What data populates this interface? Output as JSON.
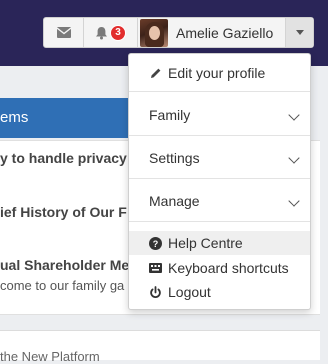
{
  "header": {
    "notification_count": "3",
    "user_name": "Amelie Gaziello"
  },
  "section": {
    "title": "ems"
  },
  "news": [
    {
      "title": "y to handle privacy a"
    },
    {
      "title": "ief History of Our F"
    },
    {
      "title": "ual Shareholder Me",
      "subtitle": "come to our family ga"
    }
  ],
  "bottom_text": "the New Platform",
  "menu": {
    "edit_profile": "Edit your profile",
    "family": "Family",
    "settings": "Settings",
    "manage": "Manage",
    "help_centre": "Help Centre",
    "keyboard_shortcuts": "Keyboard shortcuts",
    "logout": "Logout"
  },
  "colors": {
    "topbar": "#2a2558",
    "section_header": "#2f6fb5",
    "badge": "#e22d2d"
  }
}
